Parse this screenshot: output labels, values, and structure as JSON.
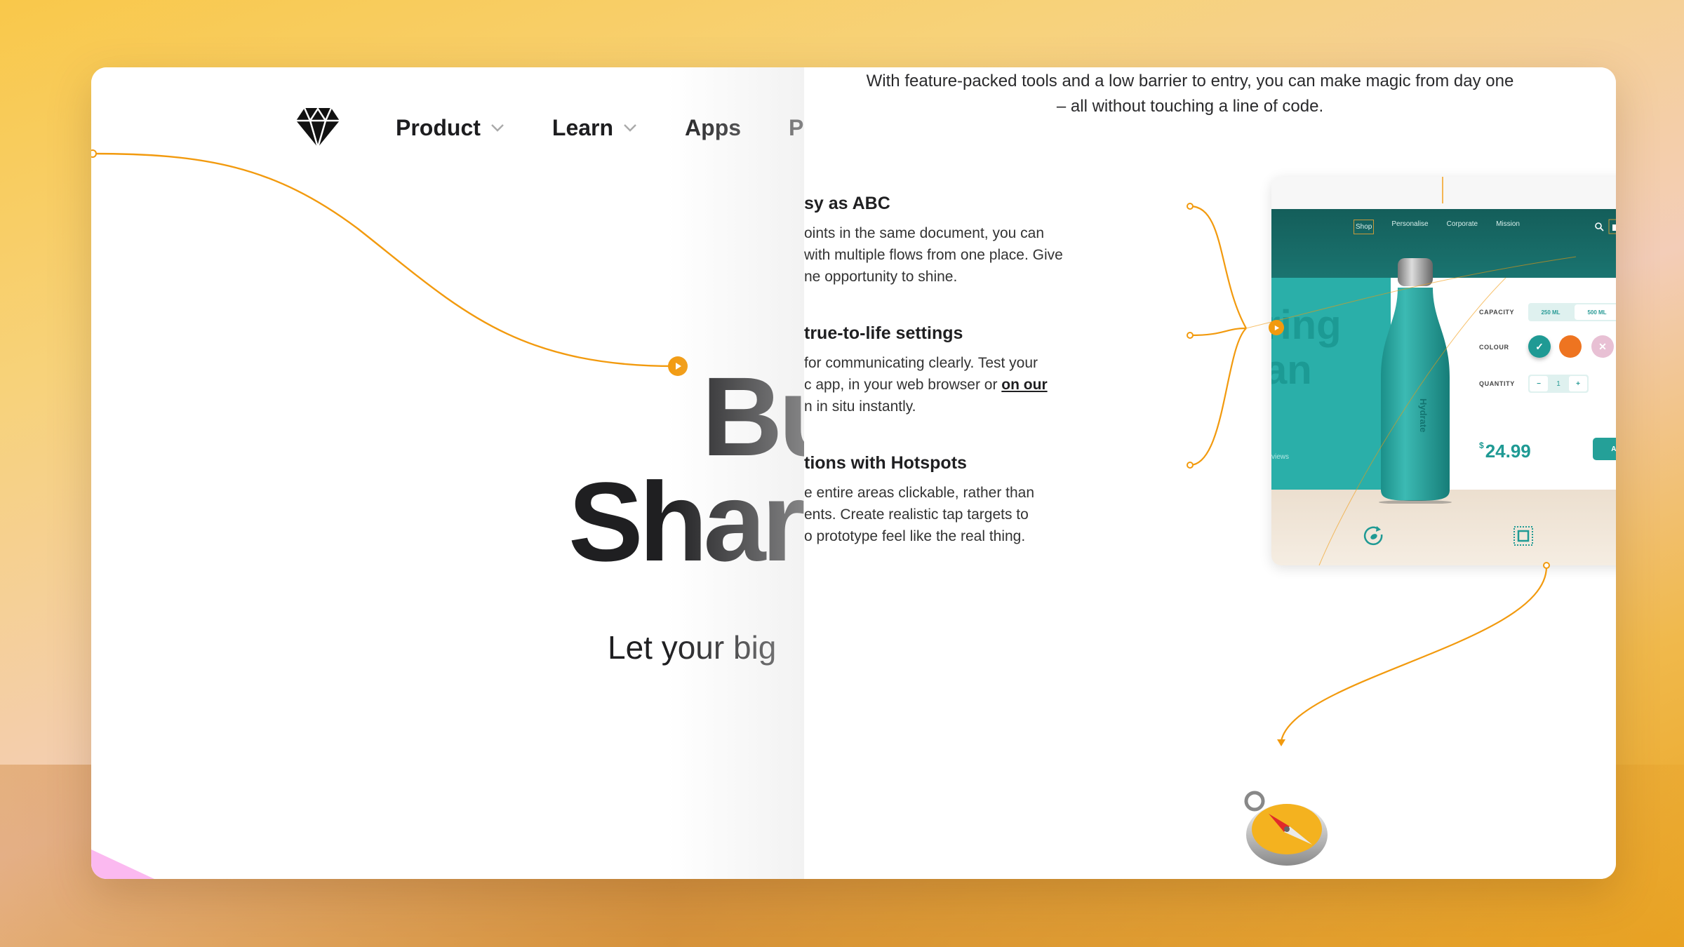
{
  "nav": {
    "logo": "sketch-diamond-logo",
    "items": [
      {
        "label": "Product",
        "has_dropdown": true
      },
      {
        "label": "Learn",
        "has_dropdown": true
      },
      {
        "label": "Apps",
        "has_dropdown": false
      },
      {
        "label": "P",
        "has_dropdown": false
      }
    ]
  },
  "hero": {
    "line1": "Bu",
    "line2": "Shar",
    "subtitle": "Let your big"
  },
  "intro": "With feature-packed tools and a low barrier to entry, you can make magic from day one – all without touching a line of code.",
  "features": [
    {
      "title": "sy as ABC",
      "lines": [
        "oints in the same document, you can",
        "with multiple flows from one place. Give",
        "ne opportunity to shine."
      ]
    },
    {
      "title": "true-to-life settings",
      "lines": [
        "for communicating clearly. Test your",
        "c app, in your web browser or ",
        "n in situ instantly."
      ],
      "link": "on our"
    },
    {
      "title": "tions with Hotspots",
      "lines": [
        "e entire areas clickable, rather than",
        "ents. Create realistic tap targets to",
        "o prototype feel like the real thing."
      ]
    }
  ],
  "mockup": {
    "nav_links": [
      "Shop",
      "Personalise",
      "Corporate",
      "Mission"
    ],
    "hero_text": [
      "ring",
      "an"
    ],
    "hero_small": "views",
    "bottle_brand": "Hydrate",
    "capacity_label": "CAPACITY",
    "capacity_options": [
      "250 ML",
      "500 ML"
    ],
    "capacity_selected": "250 ML",
    "colour_label": "COLOUR",
    "colours": [
      {
        "hex": "#1f9a94",
        "state": "selected"
      },
      {
        "hex": "#ee7420",
        "state": "available"
      },
      {
        "hex": "#e8c0d4",
        "state": "unavailable"
      },
      {
        "hex": "#5e44ae",
        "state": "available"
      }
    ],
    "quantity_label": "QUANTITY",
    "quantity": "1",
    "qty_minus": "−",
    "qty_plus": "+",
    "currency": "$",
    "price": "24.99",
    "cta": "ADD TO CART",
    "feature_icons": [
      "eco-recycle-icon",
      "insulated-square-icon",
      "water-drop-icon"
    ]
  },
  "accent_color": "#f29a0e",
  "compass_icon": "safari-compass-icon"
}
